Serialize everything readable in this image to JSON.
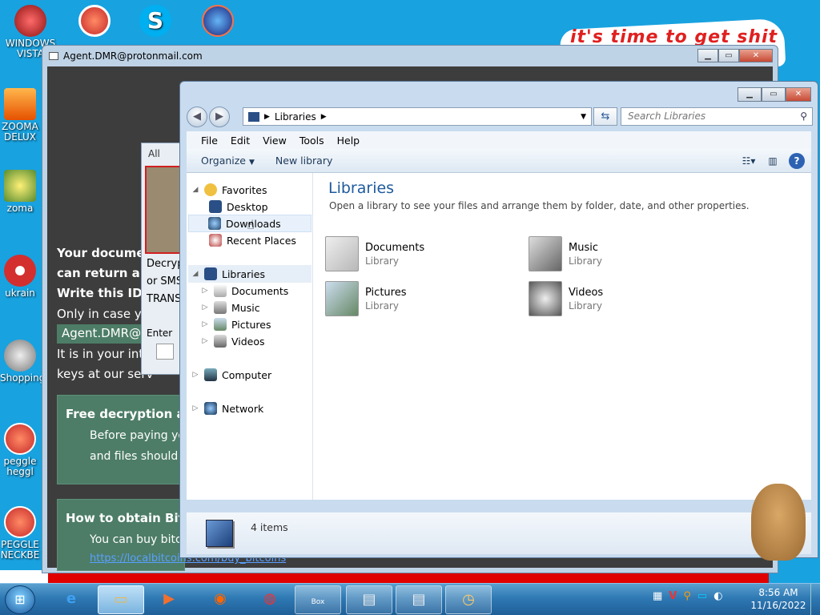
{
  "desktop": {
    "background_text": "it's time to get shit",
    "icons": [
      {
        "label": "WINDOWS VISTA",
        "color": "#c62828"
      },
      {
        "label": "ZOOMA DELUX",
        "color": "#f57f17"
      },
      {
        "label": "zoma",
        "color": "#fbc02d"
      },
      {
        "label": "ukrain",
        "color": "#d32f2f"
      },
      {
        "label": "Shopping",
        "color": "#9e9e9e"
      },
      {
        "label": "peggle heggl",
        "color": "#e53935"
      },
      {
        "label": "PEGGLE NECKBE",
        "color": "#e53935"
      }
    ],
    "top_icons": [
      "p-icon",
      "skype-icon",
      "browser-icon"
    ]
  },
  "ransom": {
    "title": "Agent.DMR@protonmail.com",
    "line1": "Your documen",
    "line2": "can return all",
    "line3": "Write this ID i",
    "line4": "Only in case you",
    "email": "Agent.DMR@ad",
    "line5": "It is in your inter",
    "line6": "keys at our serv",
    "box1_title": "Free decryption as",
    "box1_line1": "Before paying you",
    "box1_line2": "and files should n",
    "box2_title": "How to obtain Bitco",
    "box2_line1": "You can buy bitco",
    "box2_link": "https://localbitcoins.com/buy_bitcoins"
  },
  "dialog": {
    "title": "All",
    "line1": "Decryp",
    "line2": "or SMS",
    "line3": "TRANS",
    "enter": "Enter"
  },
  "explorer": {
    "address": "Libraries",
    "search_placeholder": "Search Libraries",
    "menu": [
      "File",
      "Edit",
      "View",
      "Tools",
      "Help"
    ],
    "commands": {
      "organize": "Organize",
      "new_library": "New library"
    },
    "nav": {
      "favorites": "Favorites",
      "desktop": "Desktop",
      "downloads": "Downloads",
      "recent": "Recent Places",
      "libraries": "Libraries",
      "documents": "Documents",
      "music": "Music",
      "pictures": "Pictures",
      "videos": "Videos",
      "computer": "Computer",
      "network": "Network"
    },
    "main": {
      "title": "Libraries",
      "description": "Open a library to see your files and arrange them by folder, date, and other properties.",
      "items": [
        {
          "name": "Documents",
          "type": "Library"
        },
        {
          "name": "Music",
          "type": "Library"
        },
        {
          "name": "Pictures",
          "type": "Library"
        },
        {
          "name": "Videos",
          "type": "Library"
        }
      ]
    },
    "details": {
      "count": "4 items"
    }
  },
  "taskbar": {
    "time": "8:56 AM",
    "date": "11/16/2022",
    "box_label": "Box"
  }
}
